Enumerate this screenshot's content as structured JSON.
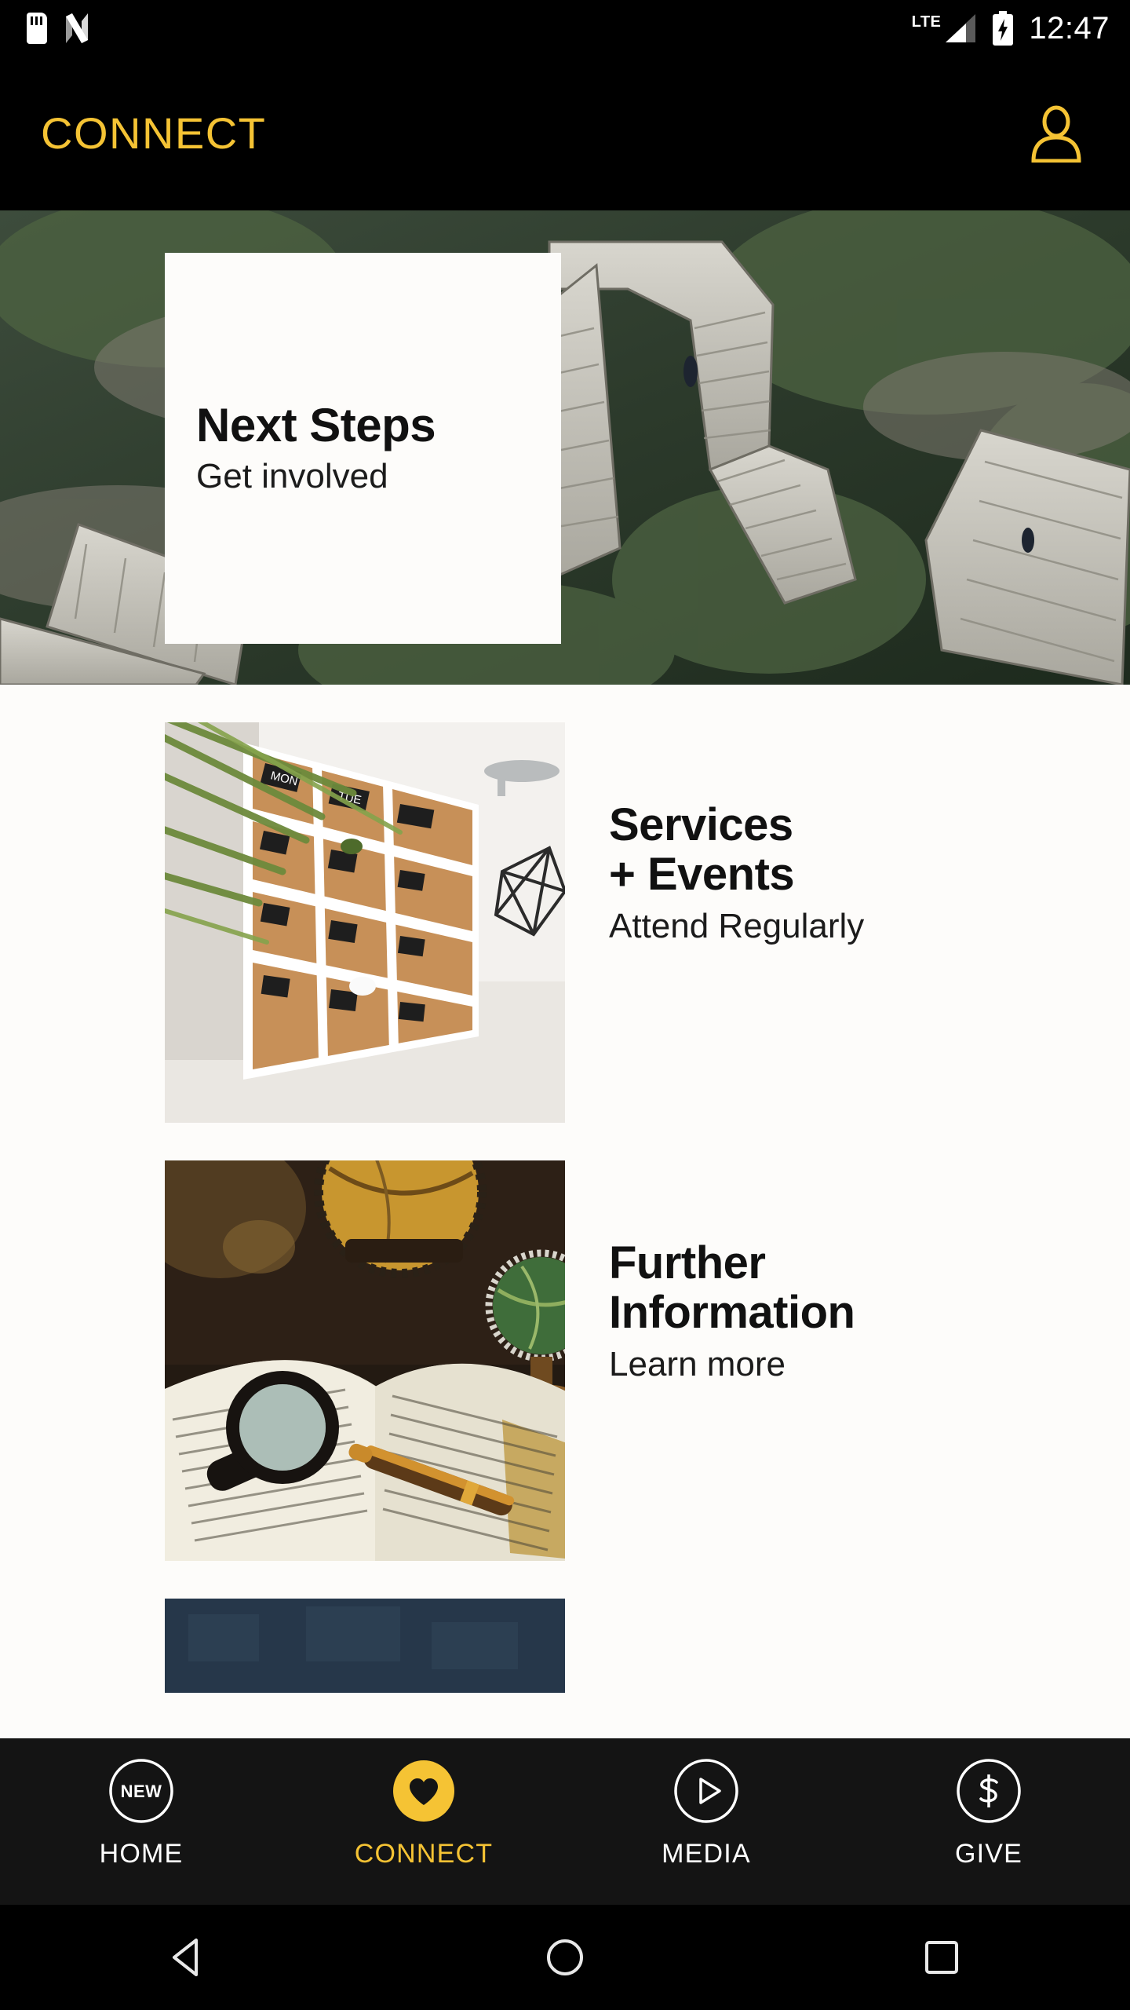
{
  "status_bar": {
    "time": "12:47",
    "network_label": "LTE",
    "icons": [
      "sd-card-icon",
      "nova-launcher-icon",
      "lte-signal-icon",
      "battery-charging-icon"
    ]
  },
  "app_bar": {
    "title": "CONNECT",
    "profile_icon": "person-icon",
    "brand_color": "#F5C334",
    "background_color": "#000000"
  },
  "hero": {
    "title": "Next Steps",
    "subtitle": "Get involved",
    "image_alt": "aerial view of concrete switchback staircases on a mossy rocky cliff",
    "card_background": "#FDFCFA"
  },
  "list": {
    "items": [
      {
        "title": "Services\n+ Events",
        "title_line1": "Services",
        "title_line2": "+ Events",
        "subtitle": "Attend Regularly",
        "image_alt": "cork wall calendar board with chalk day tags and plant leaves"
      },
      {
        "title": "Further Information",
        "title_line1": "Further",
        "title_line2": "Information",
        "subtitle": "Learn more",
        "image_alt": "open book with magnifying glass and fountain pen beside vintage globes"
      },
      {
        "title": "",
        "title_line1": "",
        "title_line2": "",
        "subtitle": "",
        "image_alt": "dark navy blue photograph, partially scrolled out of view"
      }
    ]
  },
  "tab_bar": {
    "background_color": "#141414",
    "active_color": "#F5C334",
    "tabs": [
      {
        "label": "HOME",
        "icon": "new-badge-circle-icon",
        "icon_text": "NEW",
        "active": false
      },
      {
        "label": "CONNECT",
        "icon": "heart-circle-icon",
        "icon_text": "",
        "active": true
      },
      {
        "label": "MEDIA",
        "icon": "play-circle-icon",
        "icon_text": "",
        "active": false
      },
      {
        "label": "GIVE",
        "icon": "dollar-circle-icon",
        "icon_text": "",
        "active": false
      }
    ]
  },
  "system_nav": {
    "back": "back-triangle-icon",
    "home": "home-circle-icon",
    "recents": "recents-square-icon"
  }
}
